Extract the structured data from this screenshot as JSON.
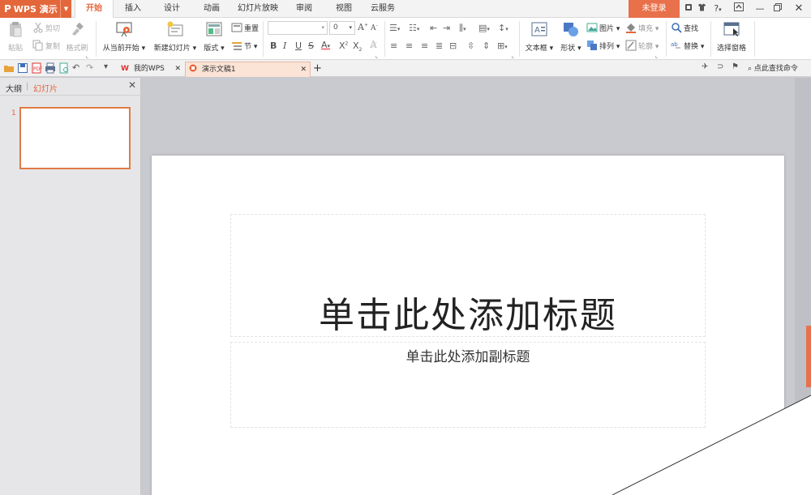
{
  "app": {
    "name": "WPS 演示",
    "p_glyph": "P"
  },
  "menu_tabs": [
    "开始",
    "插入",
    "设计",
    "动画",
    "幻灯片放映",
    "审阅",
    "视图",
    "云服务"
  ],
  "window": {
    "login_label": "未登录",
    "help": "?"
  },
  "ribbon": {
    "paste": "粘贴",
    "cut": "剪切",
    "copy": "复制",
    "format_painter": "格式刷",
    "from_current": "从当前开始",
    "new_slide": "新建幻灯片",
    "layout": "版式",
    "reset": "重置",
    "section": "节",
    "font_size": "0",
    "textbox": "文本框",
    "shape": "形状",
    "picture": "图片",
    "fill": "填充",
    "arrange": "排列",
    "outline": "轮廓",
    "find": "查找",
    "replace": "替换",
    "select_pane": "选择窗格",
    "bold": "B",
    "italic": "I",
    "underline": "U",
    "strike": "S",
    "font_color": "A"
  },
  "quickbar": {
    "tab_mywps": "我的WPS",
    "tab_doc": "演示文稿1",
    "add_tab": "+",
    "search_label": "点此查找命令"
  },
  "panel": {
    "tab_outline": "大纲",
    "tab_slides": "幻灯片",
    "slide_number": "1"
  },
  "slide": {
    "title_placeholder": "单击此处添加标题",
    "subtitle_placeholder": "单击此处添加副标题"
  },
  "colors": {
    "accent": "#e3673b",
    "login": "#e8704a"
  }
}
